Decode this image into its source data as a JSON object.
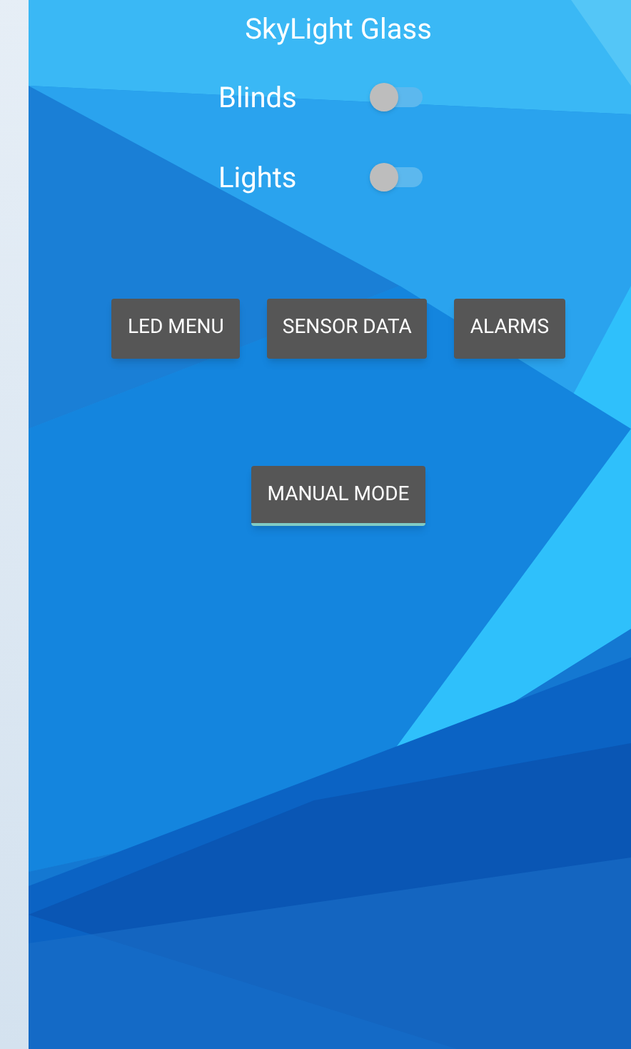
{
  "title": "SkyLight Glass",
  "switches": [
    {
      "label": "Blinds",
      "on": false
    },
    {
      "label": "Lights",
      "on": false
    }
  ],
  "buttons": [
    {
      "label": "LED MENU",
      "focused": false
    },
    {
      "label": "SENSOR DATA",
      "focused": false
    },
    {
      "label": "ALARMS",
      "focused": false
    }
  ],
  "mode_button": {
    "label": "MANUAL MODE",
    "focused": true
  }
}
